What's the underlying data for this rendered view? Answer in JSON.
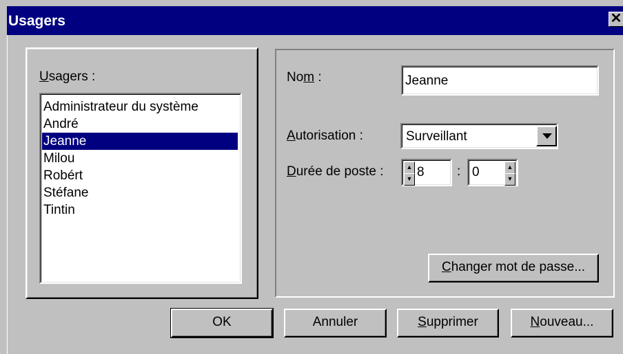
{
  "window": {
    "title": "Usagers",
    "close_glyph": "✕",
    "colors": {
      "title_bar": "#000080",
      "face": "#c0c0c0",
      "selection": "#000080"
    }
  },
  "users_panel": {
    "label_hotkey": "U",
    "label_rest": "sagers :",
    "items": [
      "Administrateur du système",
      "André",
      "Jeanne",
      "Milou",
      "Robért",
      "Stéfane",
      "Tintin"
    ],
    "selected": "Jeanne"
  },
  "details": {
    "name_label_pre": "No",
    "name_label_hotkey": "m",
    "name_label_post": " :",
    "name_value": "Jeanne",
    "auth_label_hotkey": "A",
    "auth_label_rest": "utorisation :",
    "auth_value": "Surveillant",
    "duration_label_hotkey": "D",
    "duration_label_rest": "urée de poste :",
    "hours_value": "8",
    "separator": ":",
    "minutes_value": "0",
    "change_password_hotkey": "C",
    "change_password_rest": "hanger mot de passe..."
  },
  "buttons": {
    "ok": "OK",
    "cancel": "Annuler",
    "delete_hotkey": "S",
    "delete_rest": "upprimer",
    "new_hotkey": "N",
    "new_rest": "ouveau..."
  },
  "icons": {
    "spin_up": "▲",
    "spin_down": "▼"
  }
}
